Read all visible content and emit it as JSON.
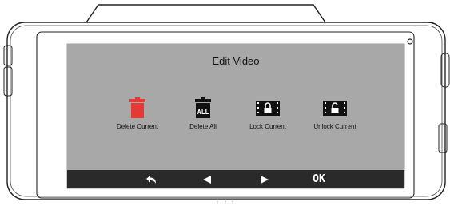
{
  "screen": {
    "title": "Edit Video"
  },
  "options": [
    {
      "label": "Delete Current",
      "icon": "trash-icon",
      "color": "#e53935"
    },
    {
      "label": "Delete All",
      "icon": "trash-all-icon",
      "icon_text": "ALL"
    },
    {
      "label": "Lock Current",
      "icon": "lock-film-icon"
    },
    {
      "label": "Unlock Current",
      "icon": "unlock-film-icon"
    }
  ],
  "navbar": {
    "buttons": [
      {
        "icon": "back-icon"
      },
      {
        "icon": "left-arrow-icon"
      },
      {
        "icon": "right-arrow-icon"
      },
      {
        "label": "OK"
      }
    ]
  }
}
